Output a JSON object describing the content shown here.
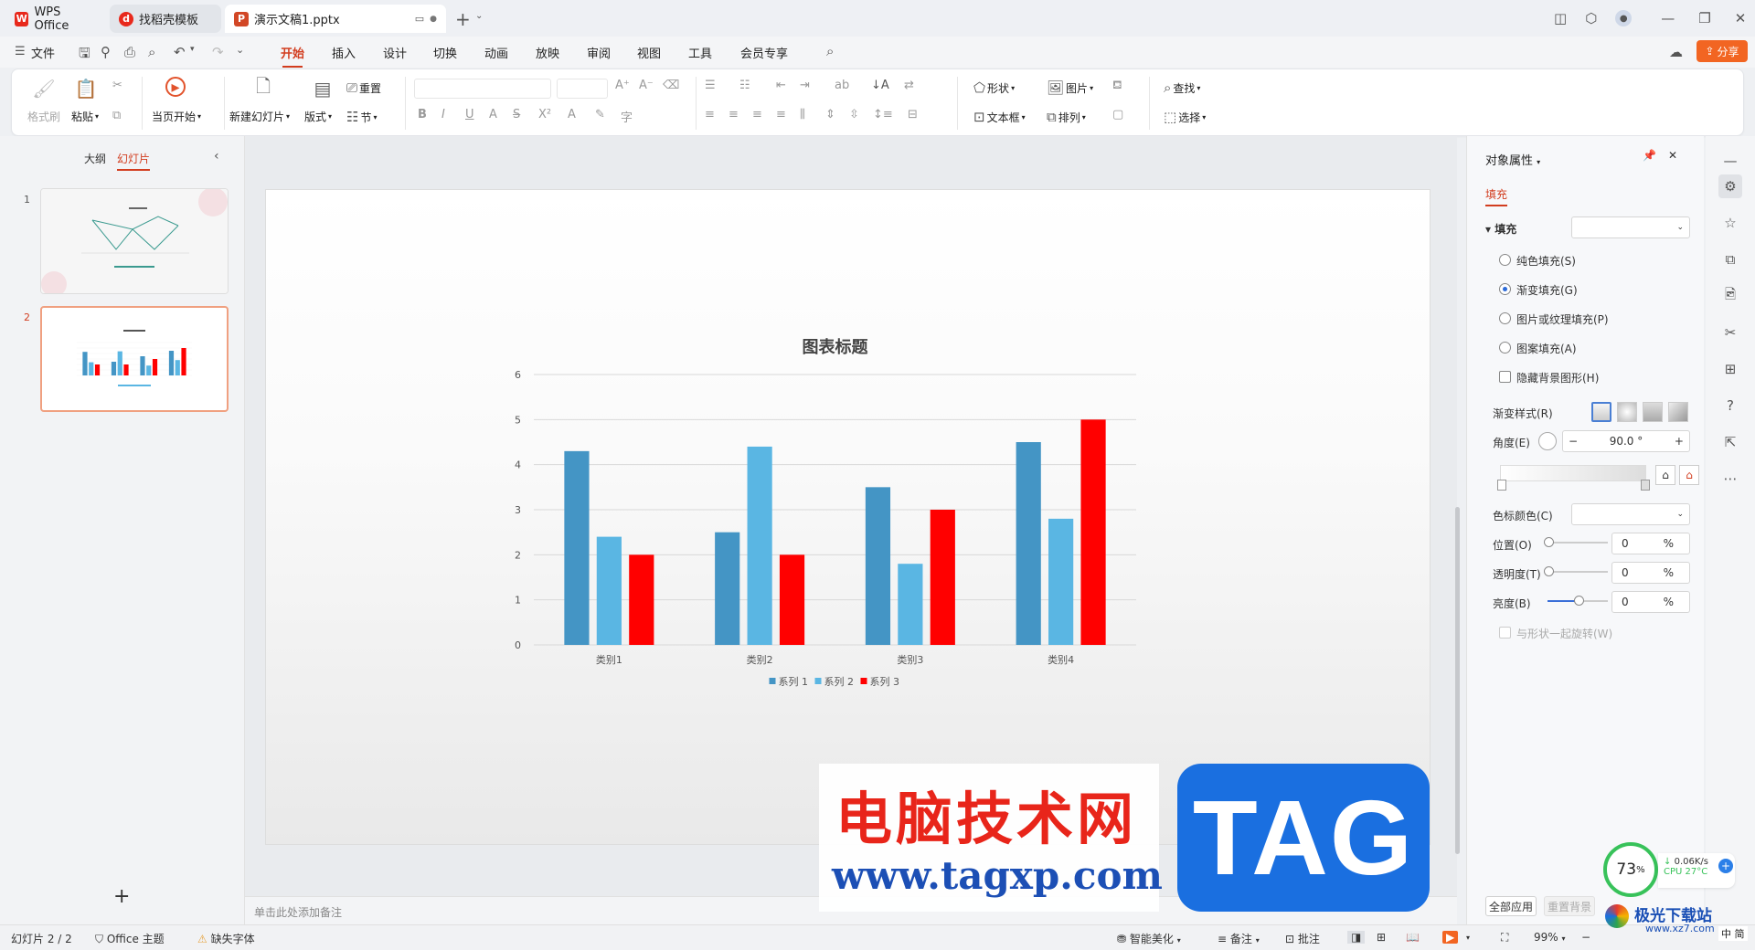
{
  "titlebar": {
    "tabs": [
      {
        "label": "WPS Office",
        "icon": "wps-logo"
      },
      {
        "label": "找稻壳模板",
        "icon": "docer-logo"
      },
      {
        "label": "演示文稿1.pptx",
        "icon": "ppt-logo"
      }
    ],
    "new_tab": "+",
    "share": "分享"
  },
  "menu": {
    "file": "文件",
    "items": [
      "开始",
      "插入",
      "设计",
      "切换",
      "动画",
      "放映",
      "审阅",
      "视图",
      "工具",
      "会员专享"
    ]
  },
  "ribbon": {
    "format_painter": "格式刷",
    "paste": "粘贴",
    "play_current": "当页开始",
    "new_slide": "新建幻灯片",
    "layout": "版式",
    "reset": "重置",
    "section": "节",
    "shape": "形状",
    "picture": "图片",
    "textbox": "文本框",
    "arrange": "排列",
    "find": "查找",
    "select": "选择"
  },
  "left_panel": {
    "tab_outline": "大纲",
    "tab_slides": "幻灯片",
    "slides": [
      {
        "num": "1"
      },
      {
        "num": "2"
      }
    ],
    "add": "+"
  },
  "chart_data": {
    "type": "bar",
    "title": "图表标题",
    "categories": [
      "类别1",
      "类别2",
      "类别3",
      "类别4"
    ],
    "series": [
      {
        "name": "系列 1",
        "values": [
          4.3,
          2.5,
          3.5,
          4.5
        ],
        "color": "#4495c5"
      },
      {
        "name": "系列 2",
        "values": [
          2.4,
          4.4,
          1.8,
          2.8
        ],
        "color": "#5ab6e3"
      },
      {
        "name": "系列 3",
        "values": [
          2.0,
          2.0,
          3.0,
          5.0
        ],
        "color": "#ff0000"
      }
    ],
    "ylim": [
      0,
      6
    ],
    "yticks": [
      "0",
      "1",
      "2",
      "3",
      "4",
      "5",
      "6"
    ],
    "legend": "bottom",
    "grid": true
  },
  "notes": {
    "placeholder": "单击此处添加备注"
  },
  "right_panel": {
    "title": "对象属性",
    "tab": "填充",
    "section": "填充",
    "options": [
      {
        "label": "纯色填充(S)",
        "checked": false
      },
      {
        "label": "渐变填充(G)",
        "checked": true
      },
      {
        "label": "图片或纹理填充(P)",
        "checked": false
      },
      {
        "label": "图案填充(A)",
        "checked": false
      }
    ],
    "hide_bg": "隐藏背景图形(H)",
    "gradient_style": "渐变样式(R)",
    "angle_label": "角度(E)",
    "angle_value": "90.0 °",
    "stop_color": "色标颜色(C)",
    "position_label": "位置(O)",
    "position_value": "0",
    "transparency_label": "透明度(T)",
    "transparency_value": "0",
    "brightness_label": "亮度(B)",
    "brightness_value": "0",
    "percent": "%",
    "rotate_with_shape": "与形状一起旋转(W)",
    "apply_all": "全部应用",
    "reset_bg": "重置背景"
  },
  "statusbar": {
    "slide_count": "幻灯片 2 / 2",
    "theme": "Office 主题",
    "missing_font": "缺失字体",
    "smart_beautify": "智能美化",
    "notes": "备注",
    "comments": "批注",
    "zoom": "99%"
  },
  "watermark": {
    "cn": "电脑技术网",
    "url": "www.tagxp.com",
    "tag": "TAG",
    "site": "极光下载站",
    "site_url": "www.xz7.com"
  },
  "monitor": {
    "percent": "73",
    "net": "0.06K/s",
    "cpu": "CPU 27°C",
    "lang": "中 简"
  }
}
